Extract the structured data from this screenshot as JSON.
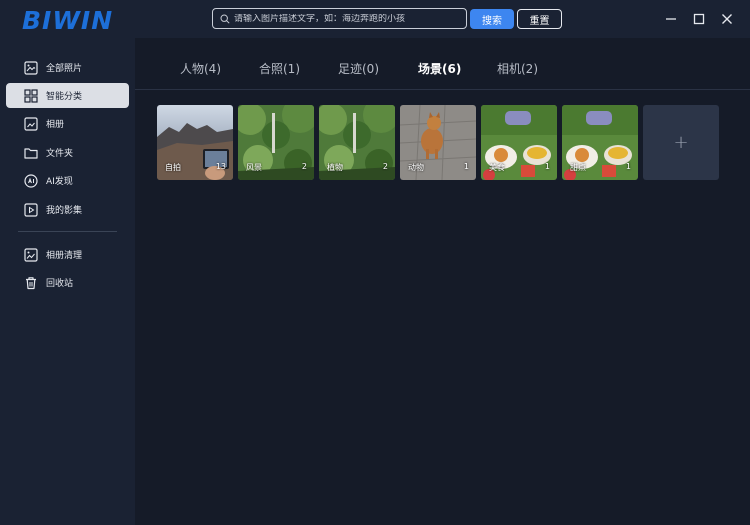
{
  "app": {
    "logo": "BIWIN"
  },
  "search": {
    "placeholder": "请输入图片描述文字，如：海边奔跑的小孩",
    "search_label": "搜索",
    "reset_label": "重置"
  },
  "sidebar": {
    "items": [
      {
        "label": "全部照片",
        "icon": "all-photos-icon"
      },
      {
        "label": "智能分类",
        "icon": "smart-category-icon",
        "active": true
      },
      {
        "label": "相册",
        "icon": "album-icon"
      },
      {
        "label": "文件夹",
        "icon": "folder-icon"
      },
      {
        "label": "AI发现",
        "icon": "ai-discover-icon"
      },
      {
        "label": "我的影集",
        "icon": "my-movies-icon"
      },
      {
        "label": "相册清理",
        "icon": "album-cleanup-icon"
      },
      {
        "label": "回收站",
        "icon": "trash-icon"
      }
    ]
  },
  "tabs": [
    {
      "label": "人物(4)"
    },
    {
      "label": "合照(1)"
    },
    {
      "label": "足迹(0)"
    },
    {
      "label": "场景(6)",
      "active": true
    },
    {
      "label": "相机(2)"
    }
  ],
  "categories": [
    {
      "label": "自拍",
      "count": "13"
    },
    {
      "label": "风景",
      "count": "2"
    },
    {
      "label": "植物",
      "count": "2"
    },
    {
      "label": "动物",
      "count": "1"
    },
    {
      "label": "美食",
      "count": "1"
    },
    {
      "label": "甜点",
      "count": "1"
    }
  ],
  "add_tile": {
    "label": "+"
  },
  "colors": {
    "accent": "#3d86f0",
    "logo": "#1d6fd8",
    "background": "#151b28",
    "sidebar": "#1a2233"
  }
}
